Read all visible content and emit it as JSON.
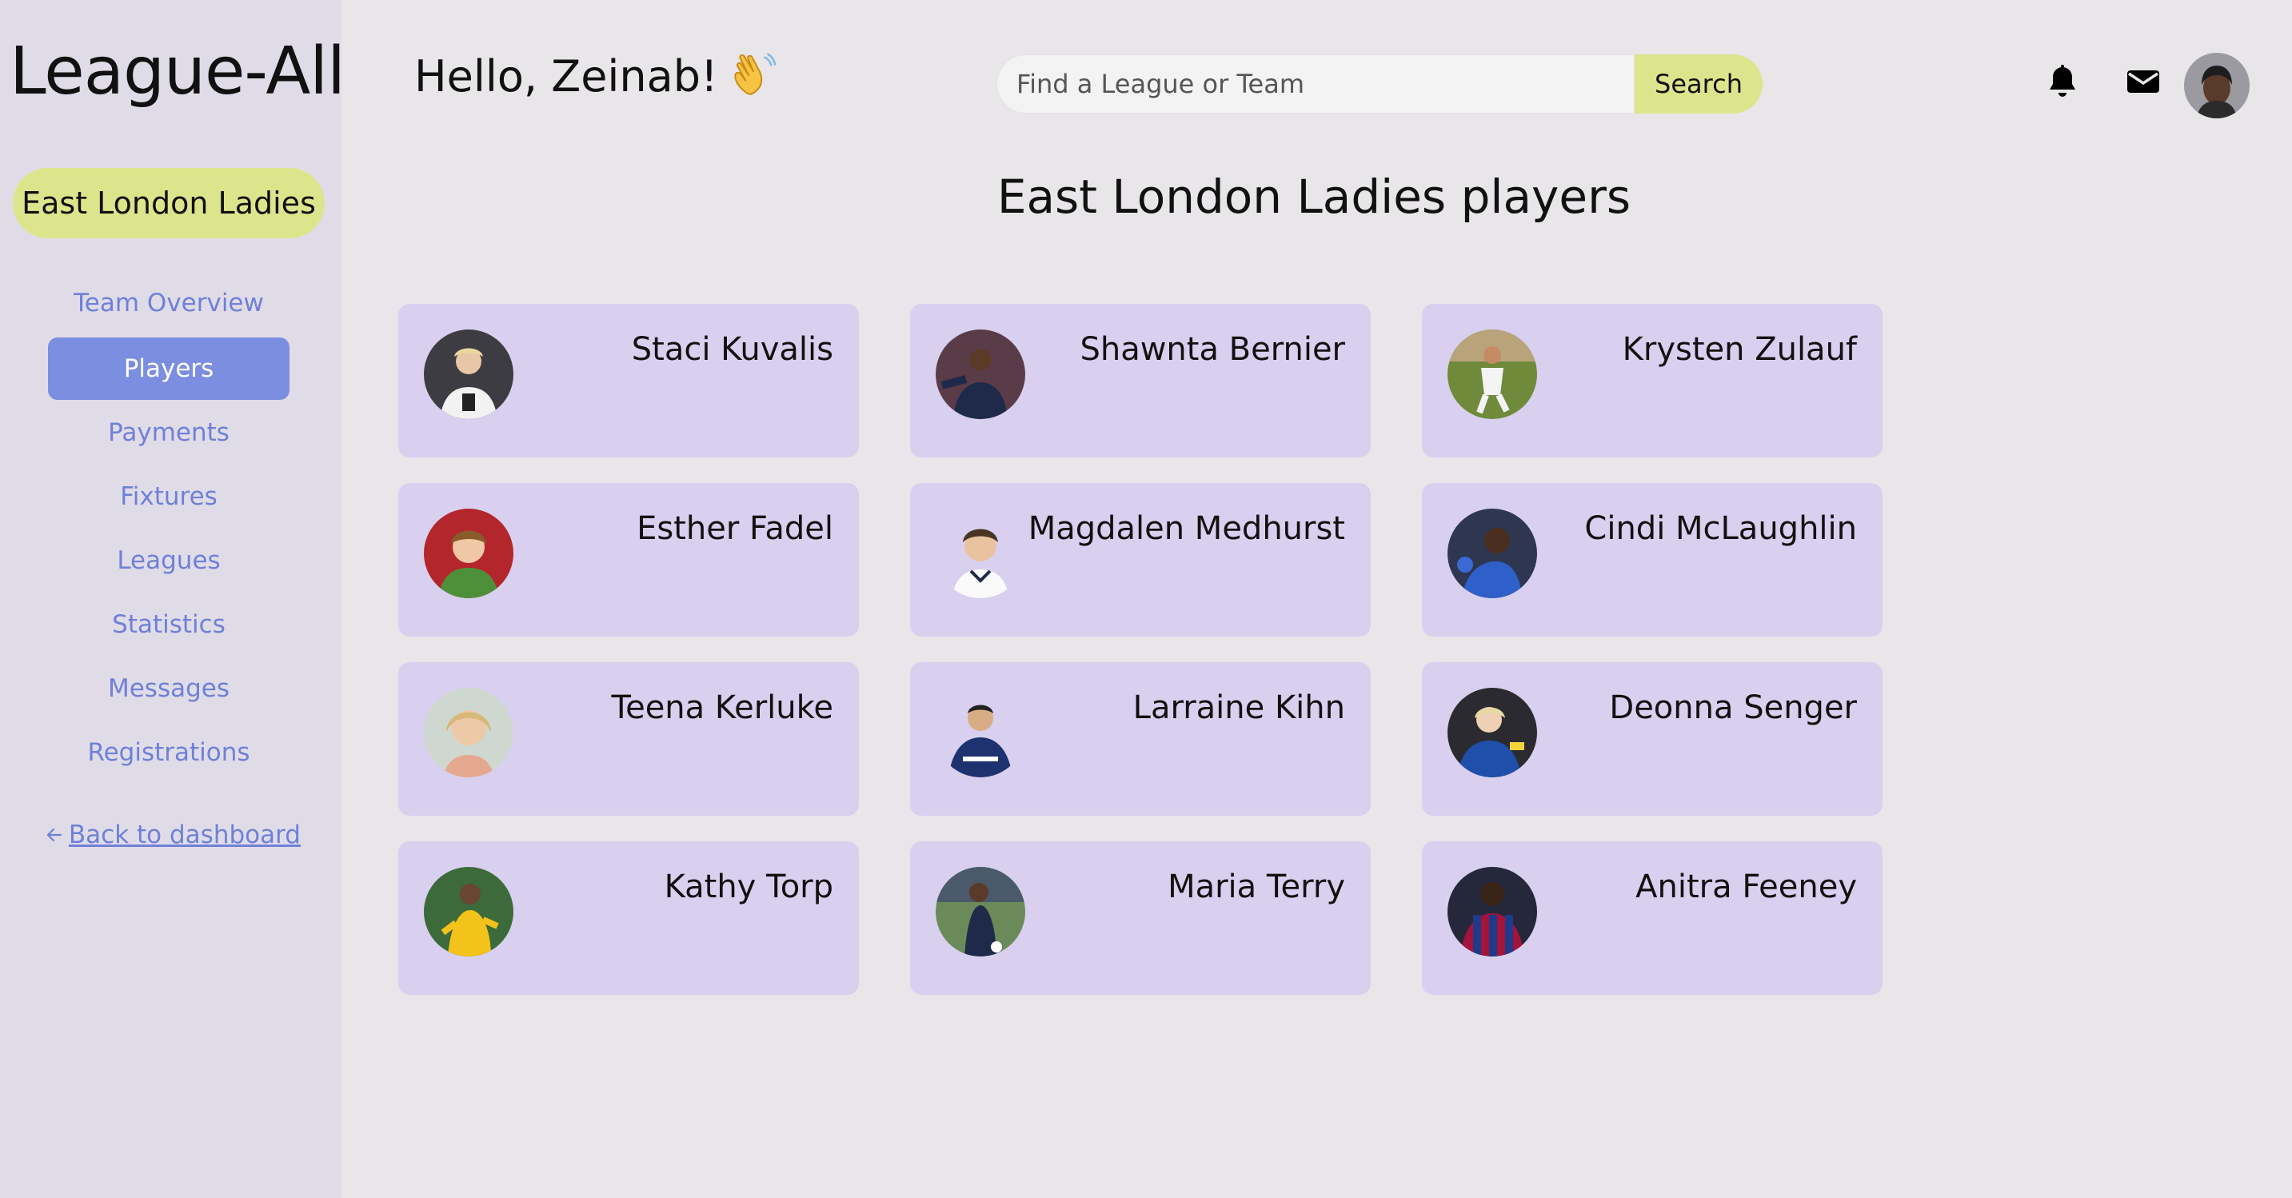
{
  "app": {
    "name": "League-All"
  },
  "sidebar": {
    "team_name": "East London Ladies",
    "items": [
      {
        "label": "Team Overview",
        "active": false
      },
      {
        "label": "Players",
        "active": true
      },
      {
        "label": "Payments",
        "active": false
      },
      {
        "label": "Fixtures",
        "active": false
      },
      {
        "label": "Leagues",
        "active": false
      },
      {
        "label": "Statistics",
        "active": false
      },
      {
        "label": "Messages",
        "active": false
      },
      {
        "label": "Registrations",
        "active": false
      }
    ],
    "back_link": {
      "label": "Back to dashboard",
      "icon": "arrow-left-icon"
    }
  },
  "header": {
    "greeting": "Hello, Zeinab!",
    "greeting_icon": "waving-hand-icon",
    "search": {
      "placeholder": "Find a League or Team",
      "button_label": "Search"
    },
    "icons": [
      "bell-icon",
      "envelope-icon"
    ],
    "avatar": "user-avatar"
  },
  "main": {
    "title": "East London Ladies players",
    "players": [
      {
        "name": "Staci Kuvalis",
        "photo": "player-photo"
      },
      {
        "name": "Shawnta Bernier",
        "photo": "player-photo"
      },
      {
        "name": "Krysten Zulauf",
        "photo": "player-photo"
      },
      {
        "name": "Esther Fadel",
        "photo": "player-photo"
      },
      {
        "name": "Magdalen Medhurst",
        "photo": "player-photo"
      },
      {
        "name": "Cindi McLaughlin",
        "photo": "player-photo"
      },
      {
        "name": "Teena Kerluke",
        "photo": "player-photo"
      },
      {
        "name": "Larraine Kihn",
        "photo": "player-photo"
      },
      {
        "name": "Deonna Senger",
        "photo": "player-photo"
      },
      {
        "name": "Kathy Torp",
        "photo": "player-photo"
      },
      {
        "name": "Maria Terry",
        "photo": "player-photo"
      },
      {
        "name": "Anitra Feeney",
        "photo": "player-photo"
      }
    ]
  },
  "colors": {
    "background": "#e8e6e9",
    "sidebar": "#e0dce7",
    "accent_yellow": "#dde58c",
    "nav_link": "#6f80d8",
    "nav_active": "#7b8ee0",
    "card": "#d9d0ef"
  }
}
